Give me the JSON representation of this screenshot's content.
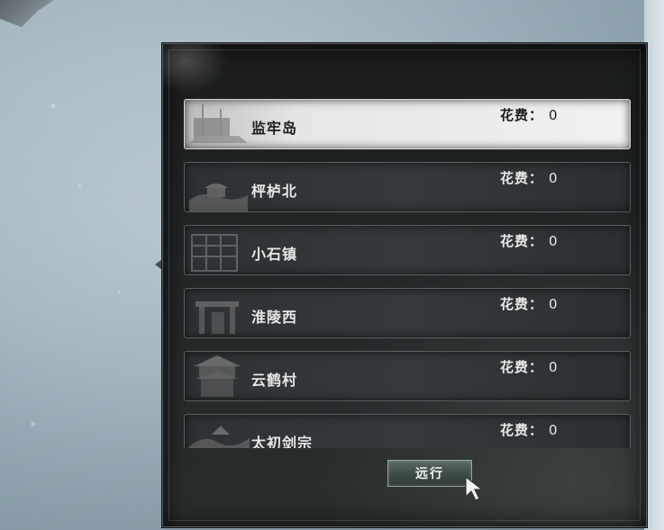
{
  "destinations": [
    {
      "name": "监牢岛",
      "cost_label": "花费：",
      "cost_value": "0",
      "selected": true
    },
    {
      "name": "枰栌北",
      "cost_label": "花费：",
      "cost_value": "0",
      "selected": false
    },
    {
      "name": "小石镇",
      "cost_label": "花费：",
      "cost_value": "0",
      "selected": false
    },
    {
      "name": "淮陵西",
      "cost_label": "花费：",
      "cost_value": "0",
      "selected": false
    },
    {
      "name": "云鹤村",
      "cost_label": "花费：",
      "cost_value": "0",
      "selected": false
    },
    {
      "name": "太初剑宗",
      "cost_label": "花费：",
      "cost_value": "0",
      "selected": false
    }
  ],
  "go_button_label": "远行",
  "colors": {
    "selected_bg": "#f1f1ef",
    "panel_bg": "#222526",
    "button": "#3f4d47"
  }
}
